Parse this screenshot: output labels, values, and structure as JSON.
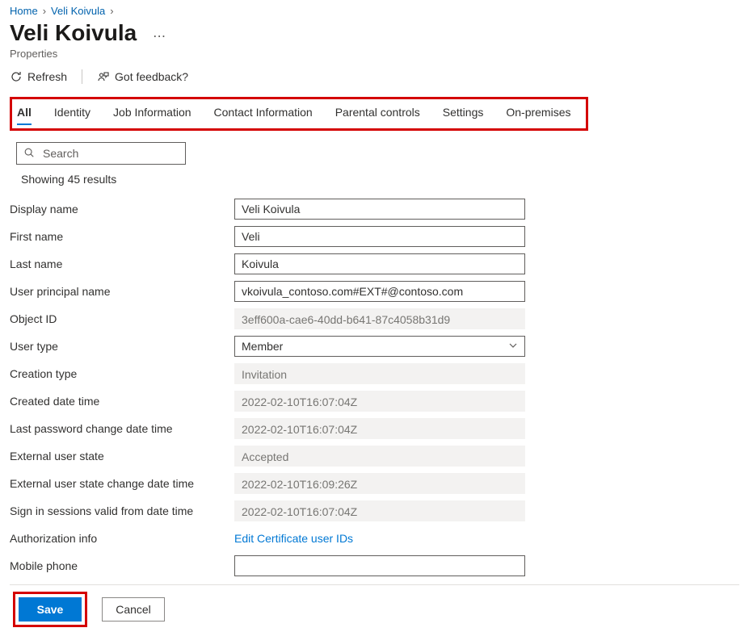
{
  "breadcrumb": {
    "items": [
      {
        "label": "Home"
      },
      {
        "label": "Veli Koivula"
      }
    ]
  },
  "header": {
    "title": "Veli Koivula",
    "subtitle": "Properties"
  },
  "commands": {
    "refresh": "Refresh",
    "feedback": "Got feedback?"
  },
  "tabs": [
    {
      "label": "All",
      "active": true
    },
    {
      "label": "Identity"
    },
    {
      "label": "Job Information"
    },
    {
      "label": "Contact Information"
    },
    {
      "label": "Parental controls"
    },
    {
      "label": "Settings"
    },
    {
      "label": "On-premises"
    }
  ],
  "search": {
    "placeholder": "Search",
    "results_text": "Showing 45 results"
  },
  "form": {
    "display_name": {
      "label": "Display name",
      "value": "Veli Koivula"
    },
    "first_name": {
      "label": "First name",
      "value": "Veli"
    },
    "last_name": {
      "label": "Last name",
      "value": "Koivula"
    },
    "upn": {
      "label": "User principal name",
      "value": "vkoivula_contoso.com#EXT#@contoso.com"
    },
    "object_id": {
      "label": "Object ID",
      "value": "3eff600a-cae6-40dd-b641-87c4058b31d9"
    },
    "user_type": {
      "label": "User type",
      "value": "Member"
    },
    "creation_type": {
      "label": "Creation type",
      "value": "Invitation"
    },
    "created": {
      "label": "Created date time",
      "value": "2022-02-10T16:07:04Z"
    },
    "last_pw_change": {
      "label": "Last password change date time",
      "value": "2022-02-10T16:07:04Z"
    },
    "ext_state": {
      "label": "External user state",
      "value": "Accepted"
    },
    "ext_state_change": {
      "label": "External user state change date time",
      "value": "2022-02-10T16:09:26Z"
    },
    "signin_valid": {
      "label": "Sign in sessions valid from date time",
      "value": "2022-02-10T16:07:04Z"
    },
    "auth_info": {
      "label": "Authorization info",
      "link": "Edit Certificate user IDs"
    },
    "mobile_phone": {
      "label": "Mobile phone",
      "value": ""
    }
  },
  "buttons": {
    "save": "Save",
    "cancel": "Cancel"
  }
}
